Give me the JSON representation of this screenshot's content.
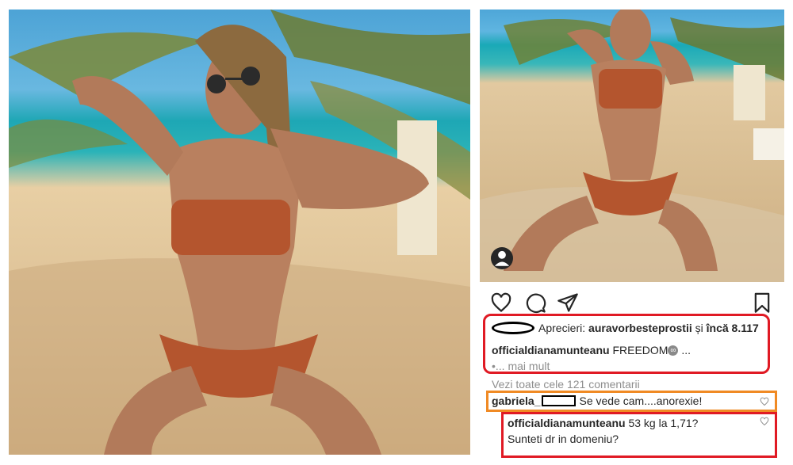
{
  "post": {
    "likes_prefix": "Aprecieri: ",
    "likes_user": "auravorbesteprostii",
    "likes_suffix_plain": " și ",
    "likes_suffix_bold": "încă 8.117",
    "caption_user": "officialdianamunteanu",
    "caption_text": " FREEDOM",
    "caption_emoji": "∞",
    "caption_ellipsis": " ...",
    "more_label": "•... mai mult",
    "view_all_comments": "Vezi toate cele 121 comentarii"
  },
  "comments": [
    {
      "user_visible": "gabriela_",
      "text": "Se vede cam....anorexie!"
    },
    {
      "user": "officialdianamunteanu",
      "text_line1": " 53 kg la 1,71?",
      "text_line2": "Sunteti dr in domeniu?"
    }
  ],
  "icons": {
    "like": "heart-icon",
    "comment": "comment-icon",
    "share": "send-icon",
    "save": "bookmark-icon",
    "tag": "user-tag-icon"
  },
  "colors": {
    "highlight_red": "#e01a24",
    "highlight_orange": "#f08a24",
    "meta_gray": "#8e8e8e",
    "text": "#262626"
  }
}
